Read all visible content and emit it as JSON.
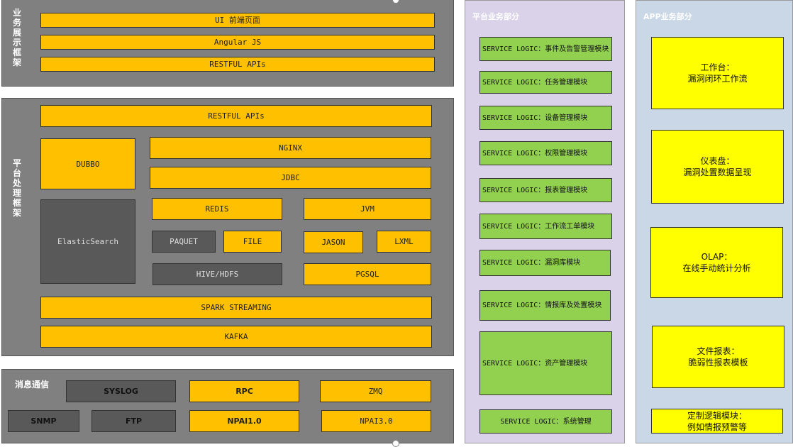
{
  "presentation": {
    "label": "业务展示框架",
    "rows": [
      "UI 前端页面",
      "Angular JS",
      "RESTFUL APIs"
    ]
  },
  "platform": {
    "label": "平台处理框架",
    "restful": "RESTFUL APIs",
    "dubbo": "DUBBO",
    "nginx": "NGINX",
    "jdbc": "JDBC",
    "elasticsearch": "ElasticSearch",
    "redis": "REDIS",
    "jvm": "JVM",
    "paquet": "PAQUET",
    "file": "FILE",
    "jason": "JASON",
    "lxml": "LXML",
    "hive": "HIVE/HDFS",
    "pgsql": "PGSQL",
    "spark": "SPARK STREAMING",
    "kafka": "KAFKA"
  },
  "messaging": {
    "label": "消息通信",
    "syslog": "SYSLOG",
    "rpc": "RPC",
    "zmq": "ZMQ",
    "snmp": "SNMP",
    "ftp": "FTP",
    "npai1": "NPAI1.0",
    "npai3": "NPAI3.0"
  },
  "platform_business": {
    "title": "平台业务部分",
    "modules": [
      "SERVICE LOGIC：事件及告警管理模块",
      "SERVICE LOGIC：任务管理模块",
      "SERVICE LOGIC：设备管理模块",
      "SERVICE LOGIC：权限管理模块",
      "SERVICE LOGIC：报表管理模块",
      "SERVICE LOGIC：工作流工单模块",
      "SERVICE LOGIC：漏洞库模块",
      "SERVICE LOGIC：情报库及处置模块",
      "SERVICE LOGIC：资产管理模块",
      "SERVICE LOGIC：系统管理"
    ]
  },
  "app_business": {
    "title": "APP业务部分",
    "items": [
      "工作台：\n漏洞闭环工作流",
      "仪表盘：\n漏洞处置数据呈现",
      "OLAP：\n在线手动统计分析",
      "文件报表：\n脆弱性报表模板",
      "定制逻辑模块：\n例如情报预警等"
    ]
  },
  "colors": {
    "panel_gray": "#808080",
    "orange": "#ffc000",
    "dark_gray": "#595959",
    "green": "#92d050",
    "yellow": "#ffff00",
    "lavender": "#d9d2e9",
    "light_blue": "#c9d7e6"
  }
}
